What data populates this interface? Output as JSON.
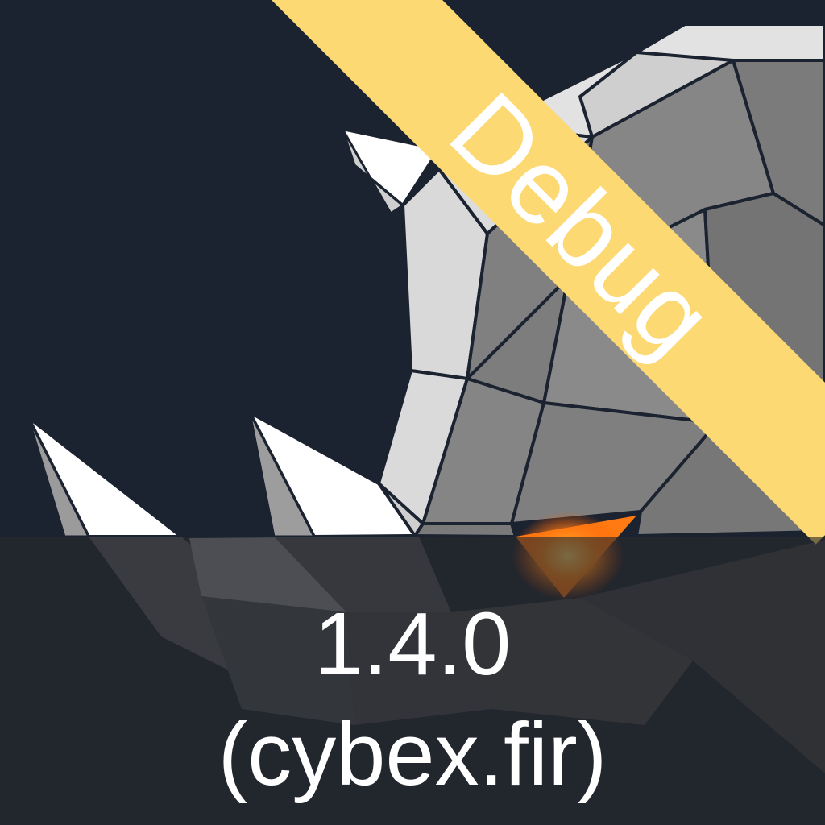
{
  "app_icon": {
    "icon_name": "polygon-rhino-icon",
    "ribbon": {
      "label": "Debug",
      "color": "#fdd974"
    },
    "version": "1.4.0",
    "build_label": "(cybex.fir)",
    "colors": {
      "background": "#1b2230",
      "mesh_light": "#d7d7d7",
      "mesh_dark": "#7a7a7a",
      "accent_glow": "#ff8a1a"
    }
  }
}
